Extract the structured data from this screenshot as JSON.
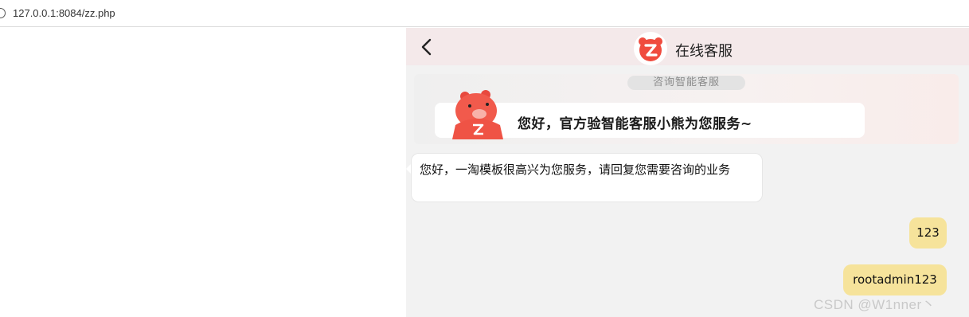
{
  "browser": {
    "url": "127.0.0.1:8084/zz.php"
  },
  "chat": {
    "header": {
      "title": "在线客服",
      "back_icon": "chevron-left-icon",
      "logo_icon": "brand-z-icon"
    },
    "banner": {
      "pill_text": "咨询智能客服",
      "greeting": "您好，官方验智能客服小熊为您服务~"
    },
    "messages": [
      {
        "from": "agent",
        "text": "您好，一淘模板很高兴为您服务，请回复您需要咨询的业务"
      },
      {
        "from": "user",
        "text": "123"
      },
      {
        "from": "user",
        "text": "rootadmin123"
      }
    ],
    "colors": {
      "header_bg": "#f4e9ea",
      "pane_bg": "#f2f2f2",
      "user_bubble": "#f6e39b",
      "brand": "#f04b3e"
    }
  },
  "watermark": "CSDN @W1nner丶"
}
